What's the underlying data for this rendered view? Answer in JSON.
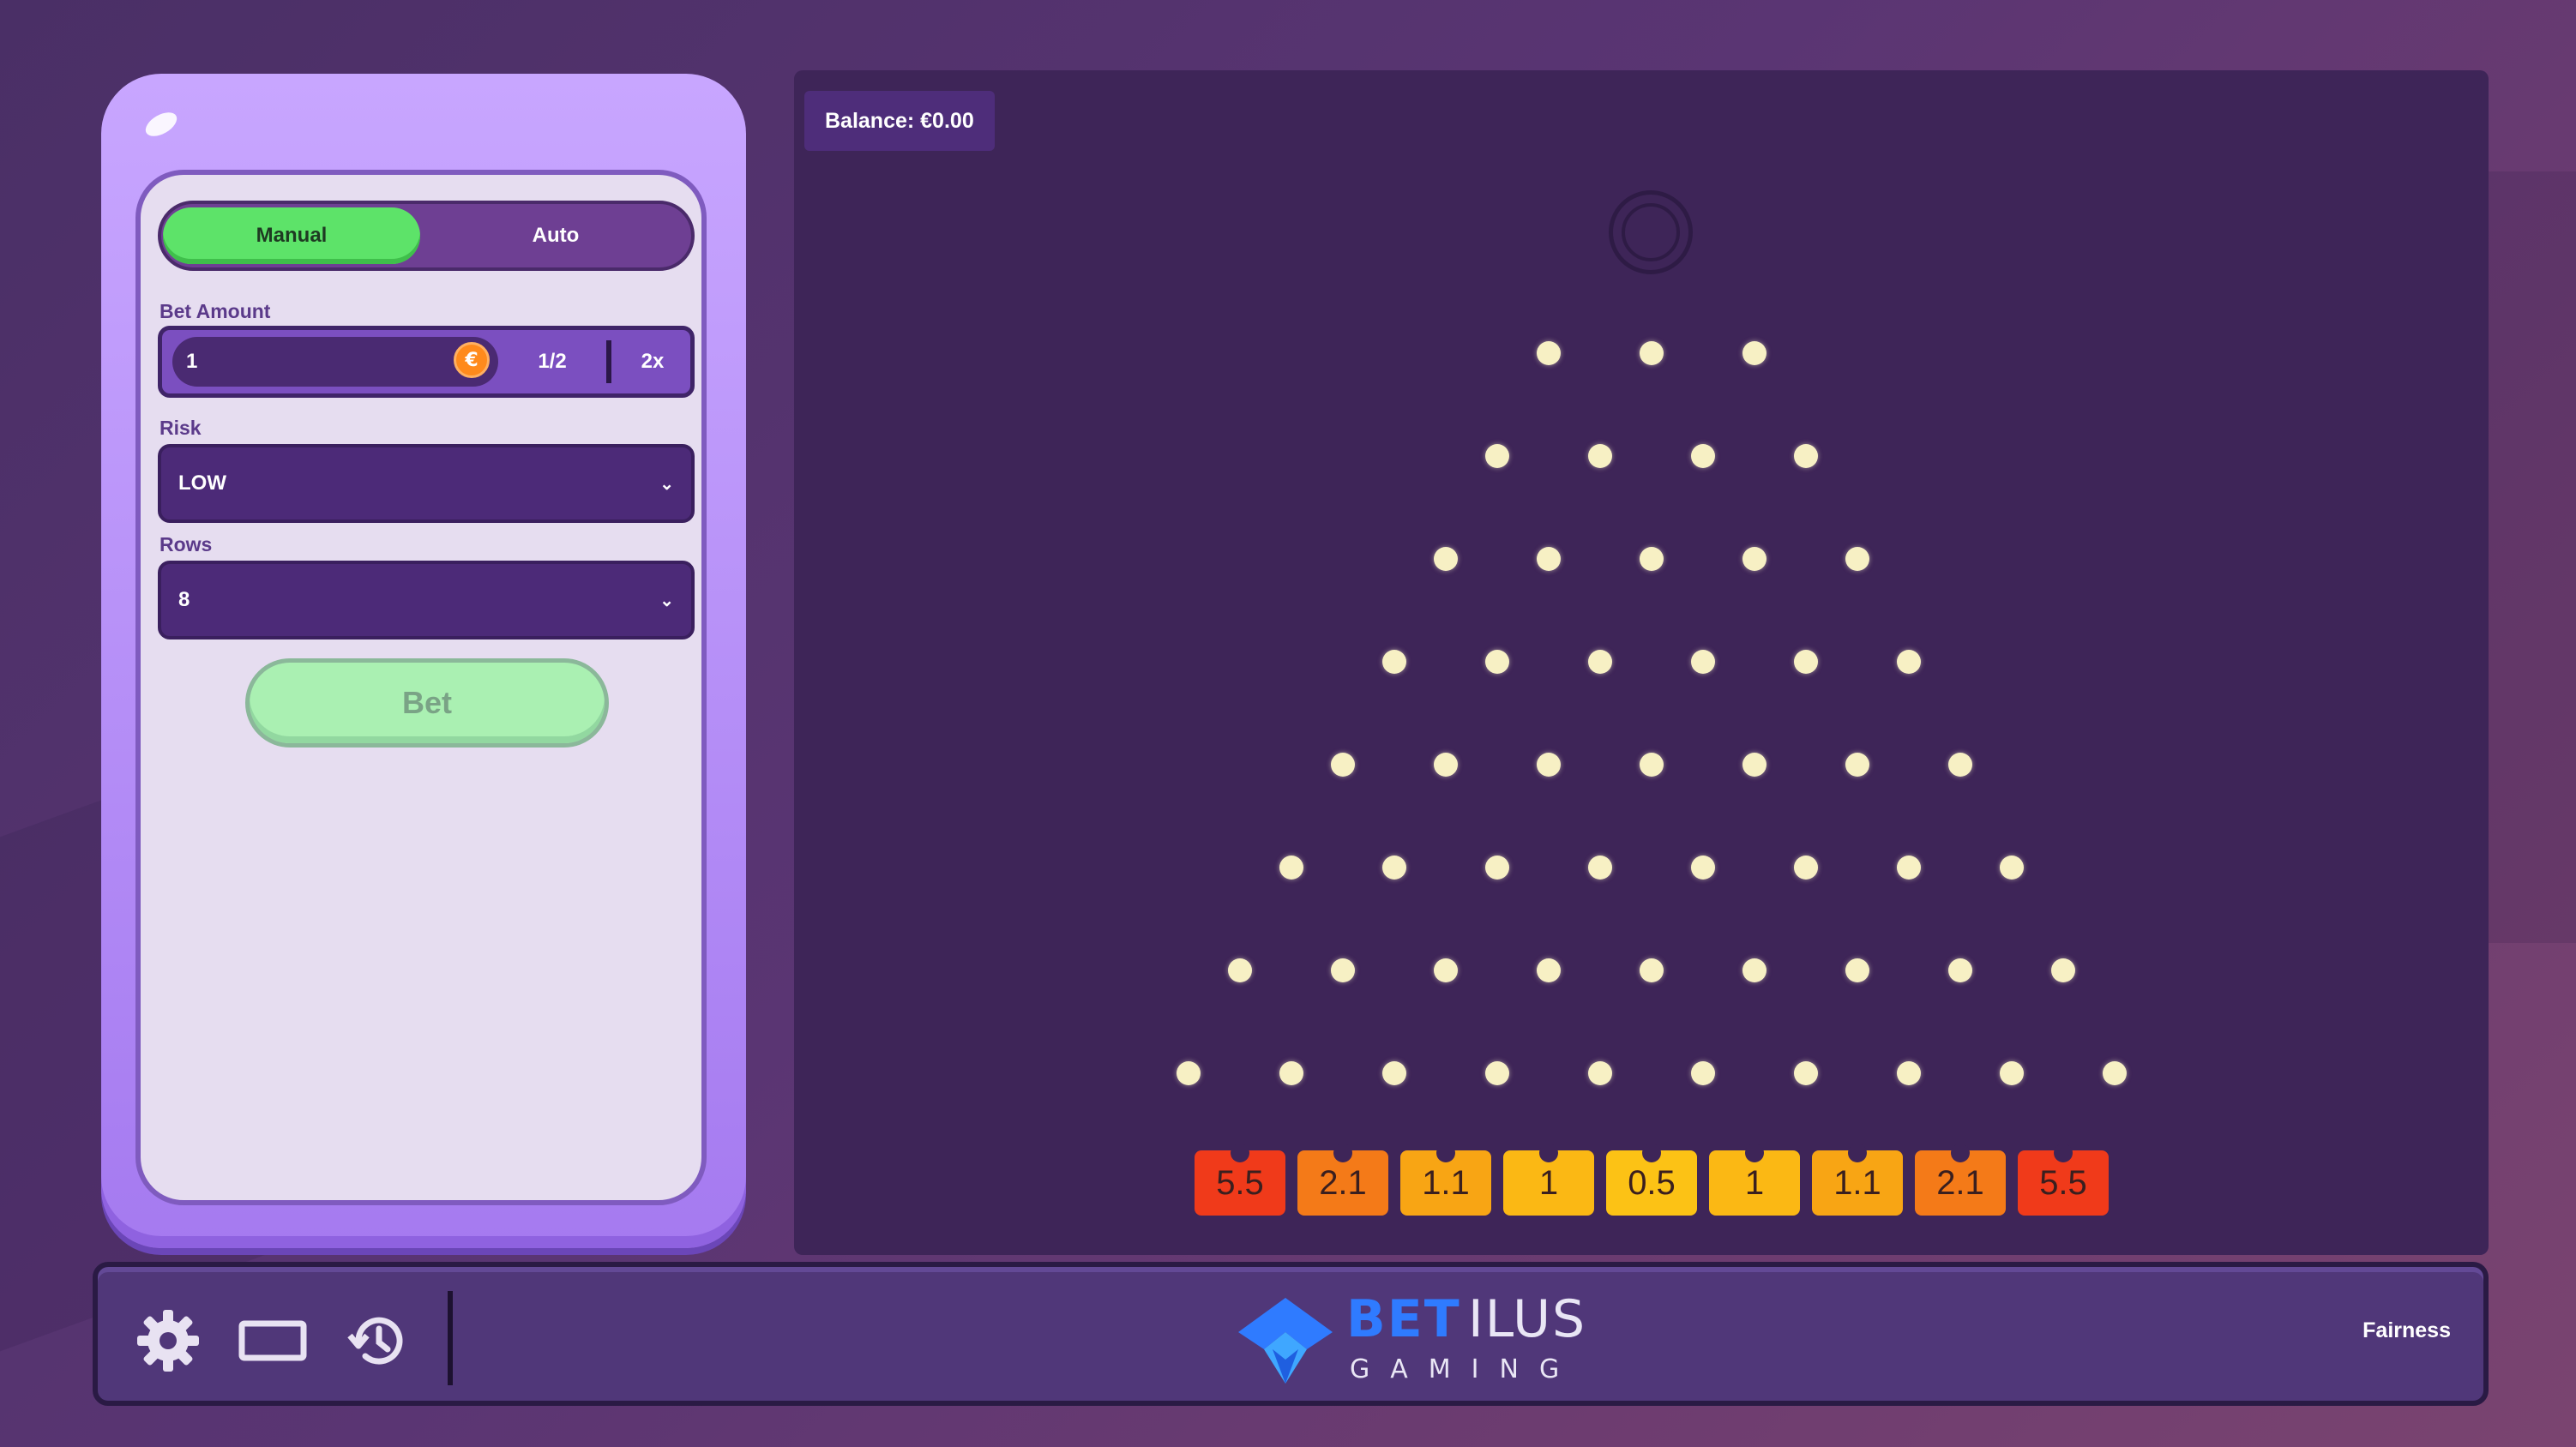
{
  "panel": {
    "modes": {
      "manual": "Manual",
      "auto": "Auto",
      "selected": "Manual"
    },
    "bet_amount": {
      "label": "Bet Amount",
      "value": "1",
      "currency_symbol": "€",
      "half_label": "1/2",
      "double_label": "2x"
    },
    "risk": {
      "label": "Risk",
      "value": "LOW"
    },
    "rows": {
      "label": "Rows",
      "value": "8"
    },
    "bet_button": "Bet"
  },
  "board": {
    "balance": "Balance: €0.00",
    "peg_rows": [
      3,
      4,
      5,
      6,
      7,
      8,
      9,
      10
    ],
    "multipliers": [
      "5.5",
      "2.1",
      "1.1",
      "1",
      "0.5",
      "1",
      "1.1",
      "2.1",
      "5.5"
    ],
    "multiplier_colors": [
      "#f03a1a",
      "#f47a18",
      "#f8a514",
      "#fbb814",
      "#fcc215",
      "#fbb814",
      "#f8a514",
      "#f47a18",
      "#f03a1a"
    ]
  },
  "bottom_bar": {
    "icons": [
      "gear-icon",
      "screen-icon",
      "history-icon"
    ],
    "brand_bet": "BET",
    "brand_ilus": "ILUS",
    "brand_gaming": "GAMING",
    "fairness": "Fairness"
  },
  "colors": {
    "accent_green": "#5de369",
    "brand_blue": "#2f7bff",
    "board_bg": "#3e2558"
  }
}
